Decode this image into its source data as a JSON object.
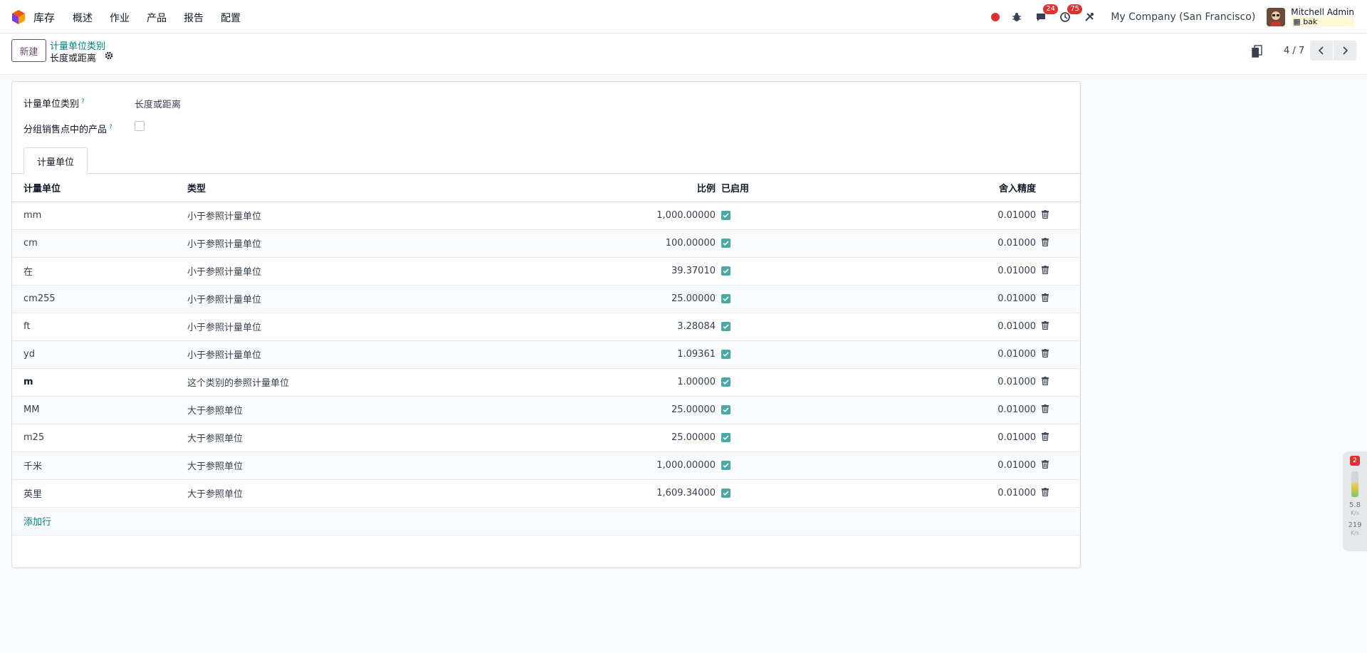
{
  "navbar": {
    "app_name": "库存",
    "menu": [
      "概述",
      "作业",
      "产品",
      "报告",
      "配置"
    ],
    "messages_count": "24",
    "activities_count": "75",
    "company": "My Company (San Francisco)",
    "user_name": "Mitchell Admin",
    "db_name": "bak"
  },
  "control_panel": {
    "new_label": "新建",
    "breadcrumb_parent": "计量单位类别",
    "breadcrumb_current": "长度或距离",
    "pager_value": "4 / 7"
  },
  "form": {
    "category_label": "计量单位类别",
    "category_value": "长度或距离",
    "group_pos_label": "分组销售点中的产品",
    "group_pos_checked": false,
    "help_mark": "?",
    "tab_label": "计量单位"
  },
  "table": {
    "headers": {
      "name": "计量单位",
      "type": "类型",
      "ratio": "比例",
      "active": "已启用",
      "rounding": "舍入精度"
    },
    "rows": [
      {
        "name": "mm",
        "type": "小于参照计量单位",
        "ratio": "1,000.00000",
        "active": true,
        "rounding": "0.01000"
      },
      {
        "name": "cm",
        "type": "小于参照计量单位",
        "ratio": "100.00000",
        "active": true,
        "rounding": "0.01000"
      },
      {
        "name": "在",
        "type": "小于参照计量单位",
        "ratio": "39.37010",
        "active": true,
        "rounding": "0.01000"
      },
      {
        "name": "cm255",
        "type": "小于参照计量单位",
        "ratio": "25.00000",
        "active": true,
        "rounding": "0.01000"
      },
      {
        "name": "ft",
        "type": "小于参照计量单位",
        "ratio": "3.28084",
        "active": true,
        "rounding": "0.01000"
      },
      {
        "name": "yd",
        "type": "小于参照计量单位",
        "ratio": "1.09361",
        "active": true,
        "rounding": "0.01000"
      },
      {
        "name": "m",
        "type": "这个类别的参照计量单位",
        "ratio": "1.00000",
        "active": true,
        "rounding": "0.01000"
      },
      {
        "name": "MM",
        "type": "大于参照单位",
        "ratio": "25.00000",
        "active": true,
        "rounding": "0.01000"
      },
      {
        "name": "m25",
        "type": "大于参照单位",
        "ratio": "25.00000",
        "active": true,
        "rounding": "0.01000"
      },
      {
        "name": "千米",
        "type": "大于参照单位",
        "ratio": "1,000.00000",
        "active": true,
        "rounding": "0.01000"
      },
      {
        "name": "英里",
        "type": "大于参照单位",
        "ratio": "1,609.34000",
        "active": true,
        "rounding": "0.01000"
      }
    ],
    "add_line_label": "添加行"
  },
  "speed_widget": {
    "badge": "2",
    "up_value": "5.8",
    "down_value": "219",
    "unit": "K/s"
  },
  "colors": {
    "brand": "#714b67",
    "link": "#017e84",
    "checkbox": "#4ba8a6",
    "badge": "#e03131"
  }
}
